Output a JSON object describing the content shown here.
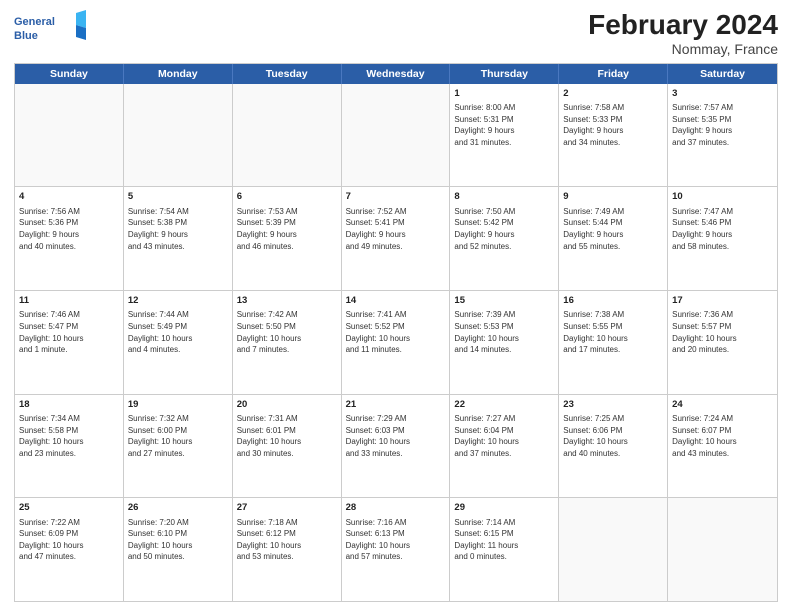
{
  "header": {
    "logo_line1": "General",
    "logo_line2": "Blue",
    "title": "February 2024",
    "subtitle": "Nommay, France"
  },
  "days": [
    "Sunday",
    "Monday",
    "Tuesday",
    "Wednesday",
    "Thursday",
    "Friday",
    "Saturday"
  ],
  "weeks": [
    [
      {
        "date": "",
        "info": ""
      },
      {
        "date": "",
        "info": ""
      },
      {
        "date": "",
        "info": ""
      },
      {
        "date": "",
        "info": ""
      },
      {
        "date": "1",
        "info": "Sunrise: 8:00 AM\nSunset: 5:31 PM\nDaylight: 9 hours\nand 31 minutes."
      },
      {
        "date": "2",
        "info": "Sunrise: 7:58 AM\nSunset: 5:33 PM\nDaylight: 9 hours\nand 34 minutes."
      },
      {
        "date": "3",
        "info": "Sunrise: 7:57 AM\nSunset: 5:35 PM\nDaylight: 9 hours\nand 37 minutes."
      }
    ],
    [
      {
        "date": "4",
        "info": "Sunrise: 7:56 AM\nSunset: 5:36 PM\nDaylight: 9 hours\nand 40 minutes."
      },
      {
        "date": "5",
        "info": "Sunrise: 7:54 AM\nSunset: 5:38 PM\nDaylight: 9 hours\nand 43 minutes."
      },
      {
        "date": "6",
        "info": "Sunrise: 7:53 AM\nSunset: 5:39 PM\nDaylight: 9 hours\nand 46 minutes."
      },
      {
        "date": "7",
        "info": "Sunrise: 7:52 AM\nSunset: 5:41 PM\nDaylight: 9 hours\nand 49 minutes."
      },
      {
        "date": "8",
        "info": "Sunrise: 7:50 AM\nSunset: 5:42 PM\nDaylight: 9 hours\nand 52 minutes."
      },
      {
        "date": "9",
        "info": "Sunrise: 7:49 AM\nSunset: 5:44 PM\nDaylight: 9 hours\nand 55 minutes."
      },
      {
        "date": "10",
        "info": "Sunrise: 7:47 AM\nSunset: 5:46 PM\nDaylight: 9 hours\nand 58 minutes."
      }
    ],
    [
      {
        "date": "11",
        "info": "Sunrise: 7:46 AM\nSunset: 5:47 PM\nDaylight: 10 hours\nand 1 minute."
      },
      {
        "date": "12",
        "info": "Sunrise: 7:44 AM\nSunset: 5:49 PM\nDaylight: 10 hours\nand 4 minutes."
      },
      {
        "date": "13",
        "info": "Sunrise: 7:42 AM\nSunset: 5:50 PM\nDaylight: 10 hours\nand 7 minutes."
      },
      {
        "date": "14",
        "info": "Sunrise: 7:41 AM\nSunset: 5:52 PM\nDaylight: 10 hours\nand 11 minutes."
      },
      {
        "date": "15",
        "info": "Sunrise: 7:39 AM\nSunset: 5:53 PM\nDaylight: 10 hours\nand 14 minutes."
      },
      {
        "date": "16",
        "info": "Sunrise: 7:38 AM\nSunset: 5:55 PM\nDaylight: 10 hours\nand 17 minutes."
      },
      {
        "date": "17",
        "info": "Sunrise: 7:36 AM\nSunset: 5:57 PM\nDaylight: 10 hours\nand 20 minutes."
      }
    ],
    [
      {
        "date": "18",
        "info": "Sunrise: 7:34 AM\nSunset: 5:58 PM\nDaylight: 10 hours\nand 23 minutes."
      },
      {
        "date": "19",
        "info": "Sunrise: 7:32 AM\nSunset: 6:00 PM\nDaylight: 10 hours\nand 27 minutes."
      },
      {
        "date": "20",
        "info": "Sunrise: 7:31 AM\nSunset: 6:01 PM\nDaylight: 10 hours\nand 30 minutes."
      },
      {
        "date": "21",
        "info": "Sunrise: 7:29 AM\nSunset: 6:03 PM\nDaylight: 10 hours\nand 33 minutes."
      },
      {
        "date": "22",
        "info": "Sunrise: 7:27 AM\nSunset: 6:04 PM\nDaylight: 10 hours\nand 37 minutes."
      },
      {
        "date": "23",
        "info": "Sunrise: 7:25 AM\nSunset: 6:06 PM\nDaylight: 10 hours\nand 40 minutes."
      },
      {
        "date": "24",
        "info": "Sunrise: 7:24 AM\nSunset: 6:07 PM\nDaylight: 10 hours\nand 43 minutes."
      }
    ],
    [
      {
        "date": "25",
        "info": "Sunrise: 7:22 AM\nSunset: 6:09 PM\nDaylight: 10 hours\nand 47 minutes."
      },
      {
        "date": "26",
        "info": "Sunrise: 7:20 AM\nSunset: 6:10 PM\nDaylight: 10 hours\nand 50 minutes."
      },
      {
        "date": "27",
        "info": "Sunrise: 7:18 AM\nSunset: 6:12 PM\nDaylight: 10 hours\nand 53 minutes."
      },
      {
        "date": "28",
        "info": "Sunrise: 7:16 AM\nSunset: 6:13 PM\nDaylight: 10 hours\nand 57 minutes."
      },
      {
        "date": "29",
        "info": "Sunrise: 7:14 AM\nSunset: 6:15 PM\nDaylight: 11 hours\nand 0 minutes."
      },
      {
        "date": "",
        "info": ""
      },
      {
        "date": "",
        "info": ""
      }
    ]
  ]
}
